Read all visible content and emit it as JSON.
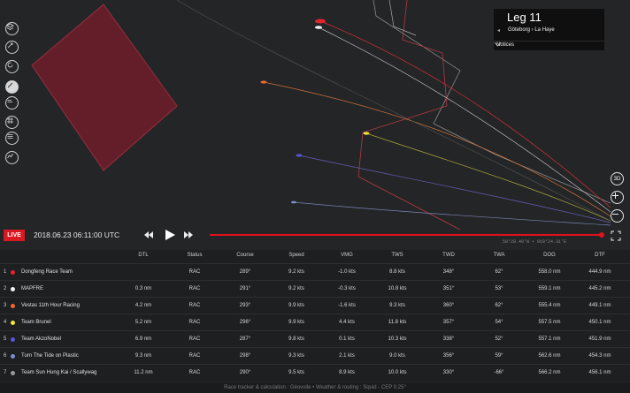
{
  "leg": {
    "title": "Leg 11",
    "route": "Göteborg › La Haye",
    "prev_arrow": "◂",
    "notices_label": "Notices"
  },
  "map_controls": {
    "mode_3d": "3D"
  },
  "toolbar_icons": [
    "layers-icon",
    "compass-icon",
    "refresh-icon",
    "edit-icon",
    "wind-icon",
    "grid-icon",
    "list-icon",
    "chart-icon"
  ],
  "playback": {
    "live_label": "LIVE",
    "datetime": "2018.06.23 06:11:00 UTC",
    "coordinates": "58°20.48'N • 010°24.31'E",
    "progress": 1.0
  },
  "table": {
    "headers": [
      "DTL",
      "Status",
      "Course",
      "Speed",
      "VMG",
      "TWS",
      "TWD",
      "TWA",
      "DOG",
      "DTF"
    ],
    "rows": [
      {
        "rank": "1",
        "team": "Dongfeng Race Team",
        "color": "#e2242c",
        "cells": [
          "",
          "RAC",
          "289°",
          "9.2 kts",
          "-1.0 kts",
          "8.8 kts",
          "348°",
          "62°",
          "558.0 nm",
          "444.9 nm"
        ]
      },
      {
        "rank": "2",
        "team": "MAPFRE",
        "color": "#f2f2f2",
        "cells": [
          "0.3 nm",
          "RAC",
          "291°",
          "9.2 kts",
          "-0.3 kts",
          "10.8 kts",
          "351°",
          "53°",
          "559.1 nm",
          "445.2 nm"
        ]
      },
      {
        "rank": "3",
        "team": "Vestas 11th Hour Racing",
        "color": "#f0662b",
        "cells": [
          "4.2 nm",
          "RAC",
          "293°",
          "9.9 kts",
          "-1.6 kts",
          "9.3 kts",
          "360°",
          "62°",
          "555.4 nm",
          "449.1 nm"
        ]
      },
      {
        "rank": "4",
        "team": "Team Brunel",
        "color": "#f5e43a",
        "cells": [
          "5.2 nm",
          "RAC",
          "296°",
          "9.9 kts",
          "4.4 kts",
          "11.8 kts",
          "357°",
          "54°",
          "557.5 nm",
          "450.1 nm"
        ]
      },
      {
        "rank": "5",
        "team": "Team AkzoNobel",
        "color": "#5a55d6",
        "cells": [
          "6.9 nm",
          "RAC",
          "287°",
          "9.8 kts",
          "0.1 kts",
          "10.3 kts",
          "338°",
          "52°",
          "557.1 nm",
          "451.9 nm"
        ]
      },
      {
        "rank": "6",
        "team": "Turn The Tide on Plastic",
        "color": "#7b8fd0",
        "cells": [
          "9.3 nm",
          "RAC",
          "298°",
          "9.3 kts",
          "2.1 kts",
          "9.0 kts",
          "356°",
          "59°",
          "562.6 nm",
          "454.3 nm"
        ]
      },
      {
        "rank": "7",
        "team": "Team Sun Hung Kai / Scallywag",
        "color": "#9a9a9a",
        "cells": [
          "11.2 nm",
          "RAC",
          "290°",
          "9.5 kts",
          "8.9 kts",
          "10.0 kts",
          "330°",
          "-66°",
          "566.2 nm",
          "456.1 nm"
        ]
      }
    ]
  },
  "footer": "Race tracker & calculation : Géovoile • Weather & routing : Squid - CEP 0.25°"
}
